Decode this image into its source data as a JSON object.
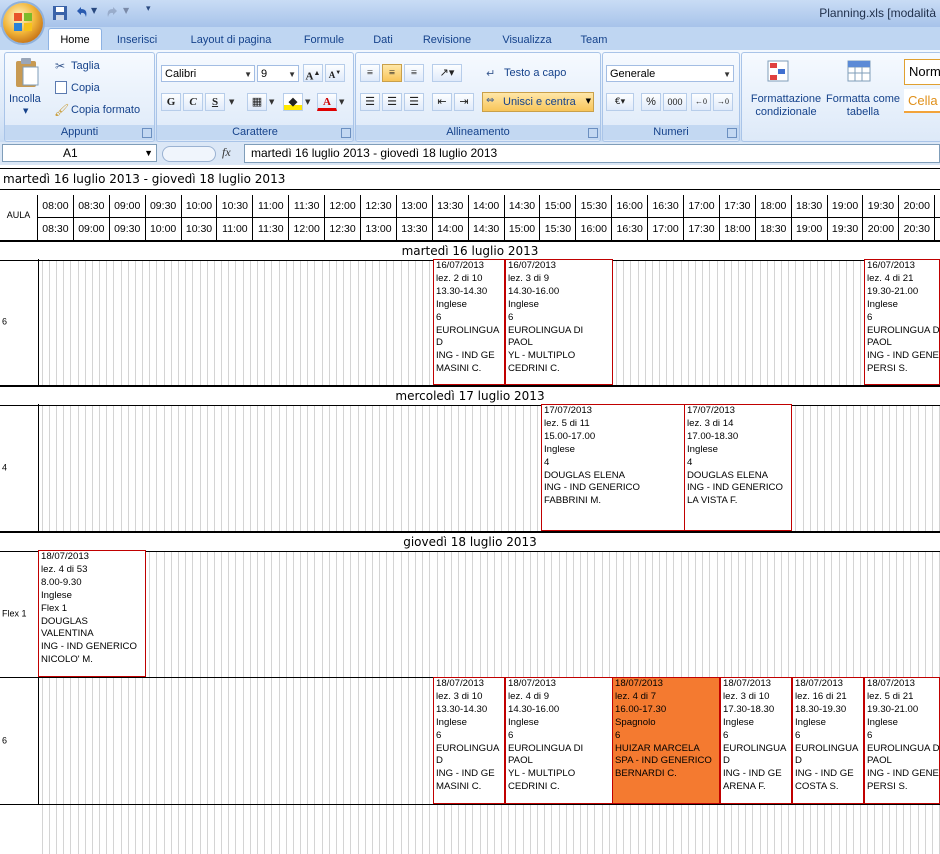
{
  "window": {
    "title": "Planning.xls  [modalità"
  },
  "tabs": [
    "Home",
    "Inserisci",
    "Layout di pagina",
    "Formule",
    "Dati",
    "Revisione",
    "Visualizza",
    "Team"
  ],
  "ribbon": {
    "clipboard": {
      "title": "Appunti",
      "paste": "Incolla",
      "cut": "Taglia",
      "copy": "Copia",
      "format_painter": "Copia formato"
    },
    "font": {
      "title": "Carattere",
      "font_name": "Calibri",
      "font_size": "9",
      "bold": "G",
      "italic": "C",
      "underline": "S"
    },
    "alignment": {
      "title": "Allineamento",
      "wrap": "Testo a capo",
      "merge": "Unisci e centra"
    },
    "number": {
      "title": "Numeri",
      "format": "Generale",
      "percent": "%",
      "thousands": "000"
    },
    "styles": {
      "conditional": "Formattazione condizionale",
      "as_table": "Formatta come tabella",
      "normal": "Norm",
      "cell": "Cella"
    }
  },
  "formula_bar": {
    "cell_ref": "A1",
    "fx": "fx",
    "content": "martedì 16 luglio 2013 - giovedì 18 luglio 2013"
  },
  "sheet": {
    "title": "martedì 16 luglio 2013 - giovedì 18 luglio 2013",
    "aula_label": "AULA",
    "time_from": [
      "08:00",
      "08:30",
      "09:00",
      "09:30",
      "10:00",
      "10:30",
      "11:00",
      "11:30",
      "12:00",
      "12:30",
      "13:00",
      "13:30",
      "14:00",
      "14:30",
      "15:00",
      "15:30",
      "16:00",
      "16:30",
      "17:00",
      "17:30",
      "18:00",
      "18:30",
      "19:00",
      "19:30",
      "20:00"
    ],
    "time_to": [
      "08:30",
      "09:00",
      "09:30",
      "10:00",
      "10:30",
      "11:00",
      "11:30",
      "12:00",
      "12:30",
      "13:00",
      "13:30",
      "14:00",
      "14:30",
      "15:00",
      "15:30",
      "16:00",
      "16:30",
      "17:00",
      "17:30",
      "18:00",
      "18:30",
      "19:00",
      "19:30",
      "20:00",
      "20:30"
    ],
    "days": [
      {
        "label": "martedì 16 luglio 2013",
        "rooms": [
          {
            "room": "6",
            "lessons": [
              {
                "slot": "13:30",
                "lines": [
                  "16/07/2013",
                  "lez. 2 di 10",
                  "13.30-14.30",
                  "Inglese",
                  "6",
                  "EUROLINGUA",
                  "D",
                  "ING - IND GE",
                  "MASINI C."
                ]
              },
              {
                "slot": "14:30",
                "lines": [
                  "16/07/2013",
                  "lez. 3 di 9",
                  "14.30-16.00",
                  "Inglese",
                  "6",
                  "EUROLINGUA DI",
                  "PAOL",
                  "YL - MULTIPLO",
                  "CEDRINI C."
                ]
              },
              {
                "slot": "19:30",
                "lines": [
                  "16/07/2013",
                  "lez. 4 di 21",
                  "19.30-21.00",
                  "Inglese",
                  "6",
                  "EUROLINGUA D",
                  "PAOL",
                  "ING - IND GENE",
                  "PERSI S."
                ]
              }
            ]
          }
        ]
      },
      {
        "label": "mercoledì 17 luglio 2013",
        "rooms": [
          {
            "room": "4",
            "lessons": [
              {
                "slot": "15:00",
                "lines": [
                  "17/07/2013",
                  "lez. 5 di 11",
                  "15.00-17.00",
                  "Inglese",
                  "4",
                  "DOUGLAS ELENA",
                  "ING - IND GENERICO",
                  "FABBRINI M."
                ]
              },
              {
                "slot": "17:00",
                "lines": [
                  "17/07/2013",
                  "lez. 3 di 14",
                  "17.00-18.30",
                  "Inglese",
                  "4",
                  "DOUGLAS ELENA",
                  "ING - IND GENERICO",
                  "LA VISTA F."
                ]
              }
            ]
          }
        ]
      },
      {
        "label": "giovedì 18 luglio 2013",
        "rooms": [
          {
            "room": "Flex 1",
            "lessons": [
              {
                "slot": "08:00",
                "lines": [
                  "18/07/2013",
                  "lez. 4 di 53",
                  "8.00-9.30",
                  "Inglese",
                  "Flex 1",
                  "DOUGLAS",
                  "VALENTINA",
                  "ING - IND GENERICO",
                  "NICOLO' M."
                ]
              }
            ]
          },
          {
            "room": "6",
            "lessons": [
              {
                "slot": "13:30",
                "lines": [
                  "18/07/2013",
                  "lez. 3 di 10",
                  "13.30-14.30",
                  "Inglese",
                  "6",
                  "EUROLINGUA",
                  "D",
                  "ING - IND GE",
                  "MASINI C."
                ]
              },
              {
                "slot": "14:30",
                "lines": [
                  "18/07/2013",
                  "lez. 4 di 9",
                  "14.30-16.00",
                  "Inglese",
                  "6",
                  "EUROLINGUA DI",
                  "PAOL",
                  "YL - MULTIPLO",
                  "CEDRINI C."
                ]
              },
              {
                "slot": "16:00",
                "highlight": true,
                "lines": [
                  "18/07/2013",
                  "lez. 4 di 7",
                  "16.00-17.30",
                  "Spagnolo",
                  "6",
                  "HUIZAR MARCELA",
                  "SPA - IND GENERICO",
                  "BERNARDI C."
                ]
              },
              {
                "slot": "17:30",
                "lines": [
                  "18/07/2013",
                  "lez. 3 di 10",
                  "17.30-18.30",
                  "Inglese",
                  "6",
                  "EUROLINGUA",
                  "D",
                  "ING - IND GE",
                  "ARENA F."
                ]
              },
              {
                "slot": "18:30",
                "lines": [
                  "18/07/2013",
                  "lez. 16 di 21",
                  "18.30-19.30",
                  "Inglese",
                  "6",
                  "EUROLINGUA",
                  "D",
                  "ING - IND GE",
                  "COSTA S."
                ]
              },
              {
                "slot": "19:30",
                "lines": [
                  "18/07/2013",
                  "lez. 5 di 21",
                  "19.30-21.00",
                  "Inglese",
                  "6",
                  "EUROLINGUA D",
                  "PAOL",
                  "ING - IND GENE",
                  "PERSI S."
                ]
              }
            ]
          }
        ]
      }
    ]
  },
  "colors": {
    "highlight": "#f47a30",
    "lesson_border": "#c00000",
    "ribbon_text": "#15428b"
  }
}
